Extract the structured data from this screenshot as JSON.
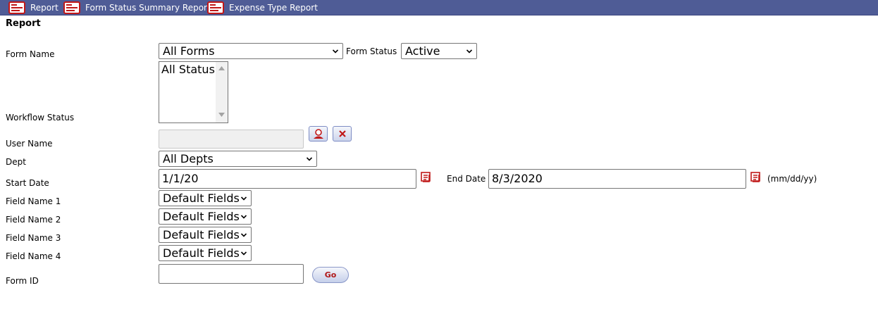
{
  "toolbar": {
    "items": [
      {
        "label": "Report"
      },
      {
        "label": "Form Status Summary Report"
      },
      {
        "label": "Expense Type Report"
      }
    ]
  },
  "section_title": "Report",
  "form_name": {
    "label": "Form Name",
    "value": "All Forms"
  },
  "form_status": {
    "label": "Form Status",
    "value": "Active"
  },
  "workflow_status": {
    "label": "Workflow Status",
    "options": [
      "All Status"
    ]
  },
  "user_name": {
    "label": "User Name",
    "value": ""
  },
  "dept": {
    "label": "Dept",
    "value": "All Depts"
  },
  "start_date": {
    "label": "Start Date",
    "value": "1/1/20"
  },
  "end_date": {
    "label": "End Date",
    "value": "8/3/2020",
    "format_hint": "(mm/dd/yy)"
  },
  "fields": [
    {
      "label": "Field Name 1",
      "value": "Default Fields"
    },
    {
      "label": "Field Name 2",
      "value": "Default Fields"
    },
    {
      "label": "Field Name 3",
      "value": "Default Fields"
    },
    {
      "label": "Field Name 4",
      "value": "Default Fields"
    }
  ],
  "form_id": {
    "label": "Form ID",
    "value": ""
  },
  "go_button": {
    "label": "Go"
  },
  "icons": {
    "report": "report-icon",
    "user_lookup": "user-lookup-icon",
    "clear": "close-icon",
    "calendar": "calendar-icon"
  },
  "colors": {
    "toolbar_bg": "#4f5c96",
    "icon_red": "#c01818",
    "go_text": "#b01818"
  }
}
